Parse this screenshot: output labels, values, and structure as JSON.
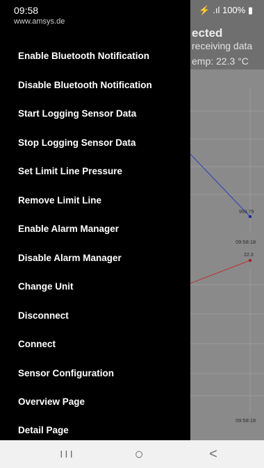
{
  "status_bar": {
    "time": "09:58",
    "signal": "⚡ .ıl",
    "battery": "100%",
    "battery_icon": "▮"
  },
  "background_app": {
    "status_title": "ected",
    "receiving_text": "receiving data",
    "temp_text": "emp: 22.3 °C",
    "pressure_chart": {
      "last_value_label": "993.79",
      "time_label": "09:58:18"
    },
    "temperature_chart": {
      "last_value_label": "22.3",
      "time_label": "09:58:18"
    }
  },
  "drawer": {
    "url": "www.amsys.de",
    "items": [
      {
        "label": "Enable Bluetooth Notification"
      },
      {
        "label": "Disable Bluetooth Notification"
      },
      {
        "label": "Start Logging Sensor Data"
      },
      {
        "label": "Stop Logging Sensor Data"
      },
      {
        "label": "Set Limit Line Pressure"
      },
      {
        "label": "Remove Limit Line"
      },
      {
        "label": "Enable Alarm Manager"
      },
      {
        "label": "Disable Alarm Manager"
      },
      {
        "label": "Change Unit"
      },
      {
        "label": "Disconnect"
      },
      {
        "label": "Connect"
      },
      {
        "label": "Sensor Configuration"
      },
      {
        "label": "Overview Page"
      },
      {
        "label": "Detail Page"
      }
    ]
  },
  "navbar": {
    "recents_glyph": "III",
    "home_glyph": "○",
    "back_glyph": "<"
  },
  "colors": {
    "drawer_bg": "#000000",
    "line_blue": "#3b46b8",
    "line_red": "#b33a3a"
  }
}
